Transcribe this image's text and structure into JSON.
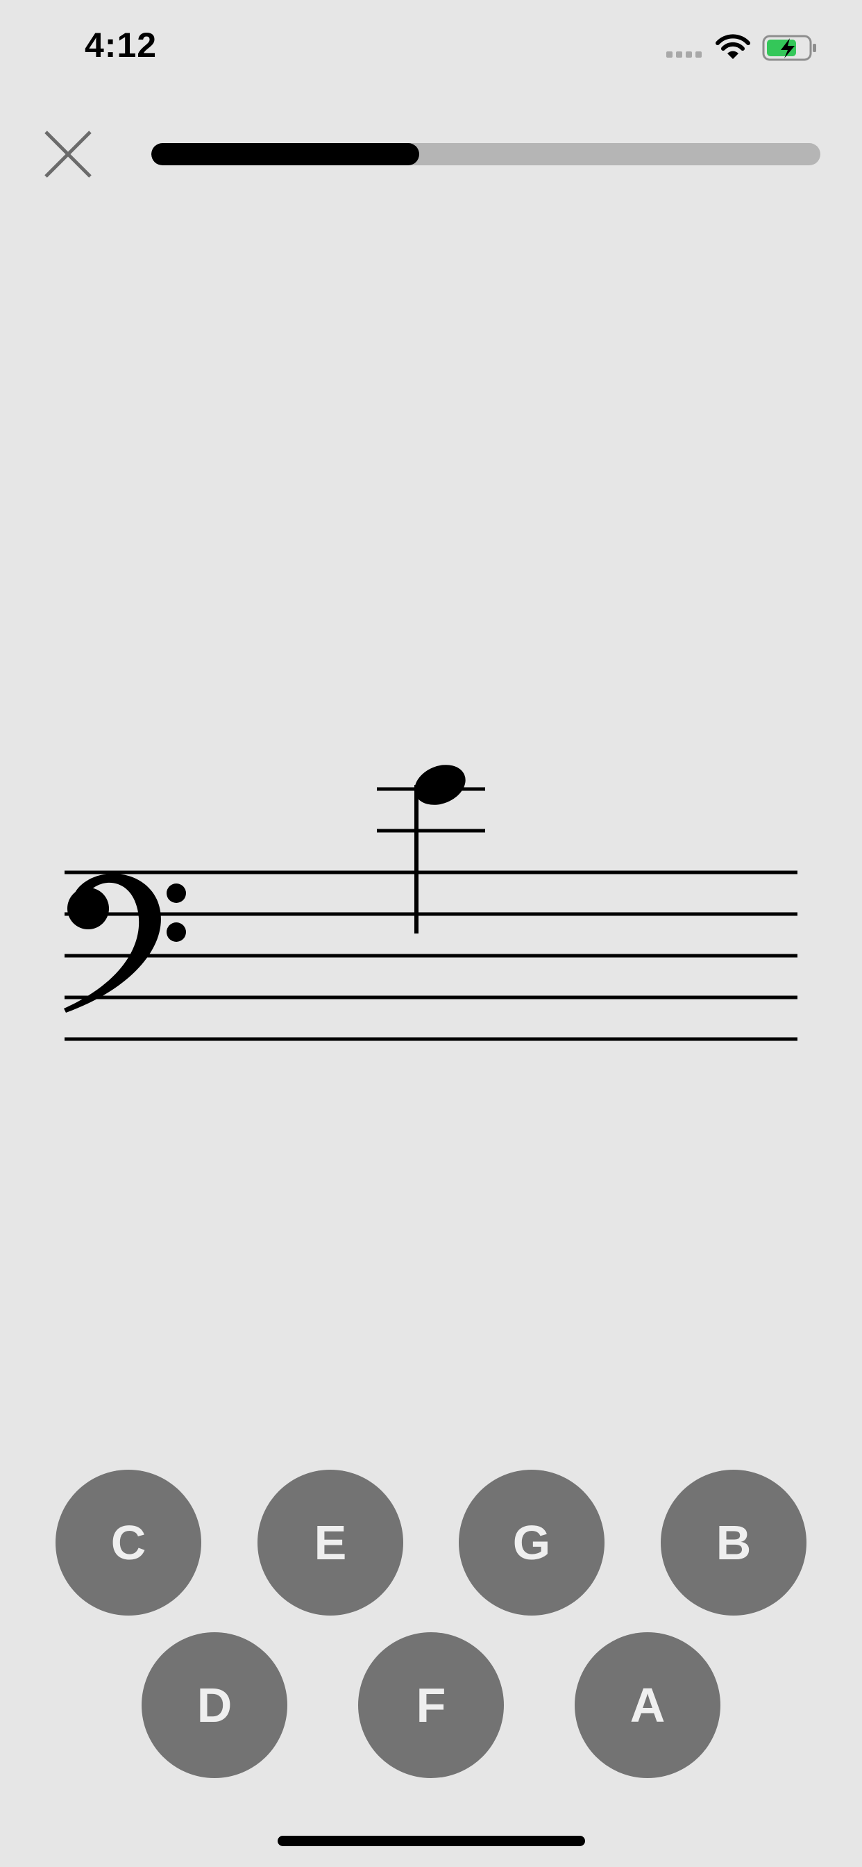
{
  "status_bar": {
    "time": "4:12",
    "icons": [
      "cellular-signal-icon",
      "wifi-icon",
      "battery-charging-icon"
    ],
    "battery_color": "#34c759"
  },
  "header": {
    "close_icon": "close-icon",
    "progress_fraction": 0.4
  },
  "staff": {
    "clef": "bass-clef",
    "note": {
      "duration": "quarter",
      "ledger_lines_above": 2
    }
  },
  "answer_buttons": {
    "row1": [
      "C",
      "E",
      "G",
      "B"
    ],
    "row2": [
      "D",
      "F",
      "A"
    ]
  },
  "colors": {
    "background": "#e6e6e6",
    "button": "#737373",
    "button_text": "#efefef",
    "progress_fill": "#000000",
    "progress_track": "#b5b5b5"
  }
}
